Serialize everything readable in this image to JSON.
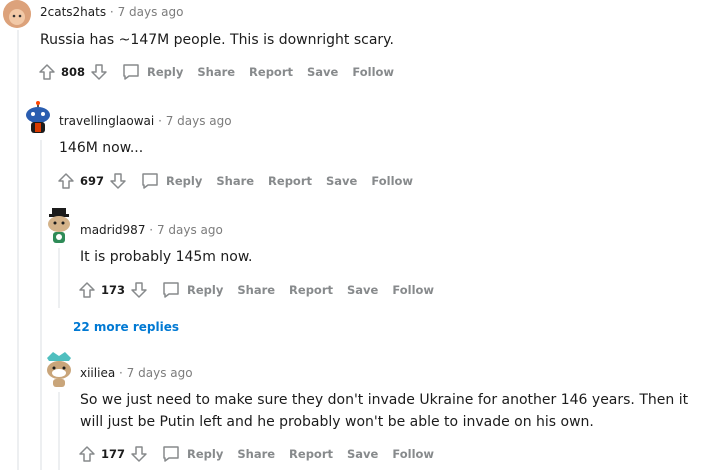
{
  "comments": [
    {
      "user": "2cats2hats",
      "time": "7 days ago",
      "text": "Russia has ~147M people. This is downright scary.",
      "score": "808"
    },
    {
      "user": "travellinglaowai",
      "time": "7 days ago",
      "text": "146M now...",
      "score": "697"
    },
    {
      "user": "madrid987",
      "time": "7 days ago",
      "text": "It is probably 145m now.",
      "score": "173"
    },
    {
      "user": "xiiliea",
      "time": "7 days ago",
      "text": "So we just need to make sure they don't invade Ukraine for another 146 years. Then it will just be Putin left and he probably won't be able to invade on his own.",
      "score": "177"
    }
  ],
  "actions": {
    "reply": "Reply",
    "share": "Share",
    "report": "Report",
    "save": "Save",
    "follow": "Follow"
  },
  "separator": "·",
  "more_replies": "22 more replies",
  "colors": {
    "action_gray": "#878a8c",
    "link_blue": "#0079d3",
    "thread_line": "#edeff1"
  }
}
